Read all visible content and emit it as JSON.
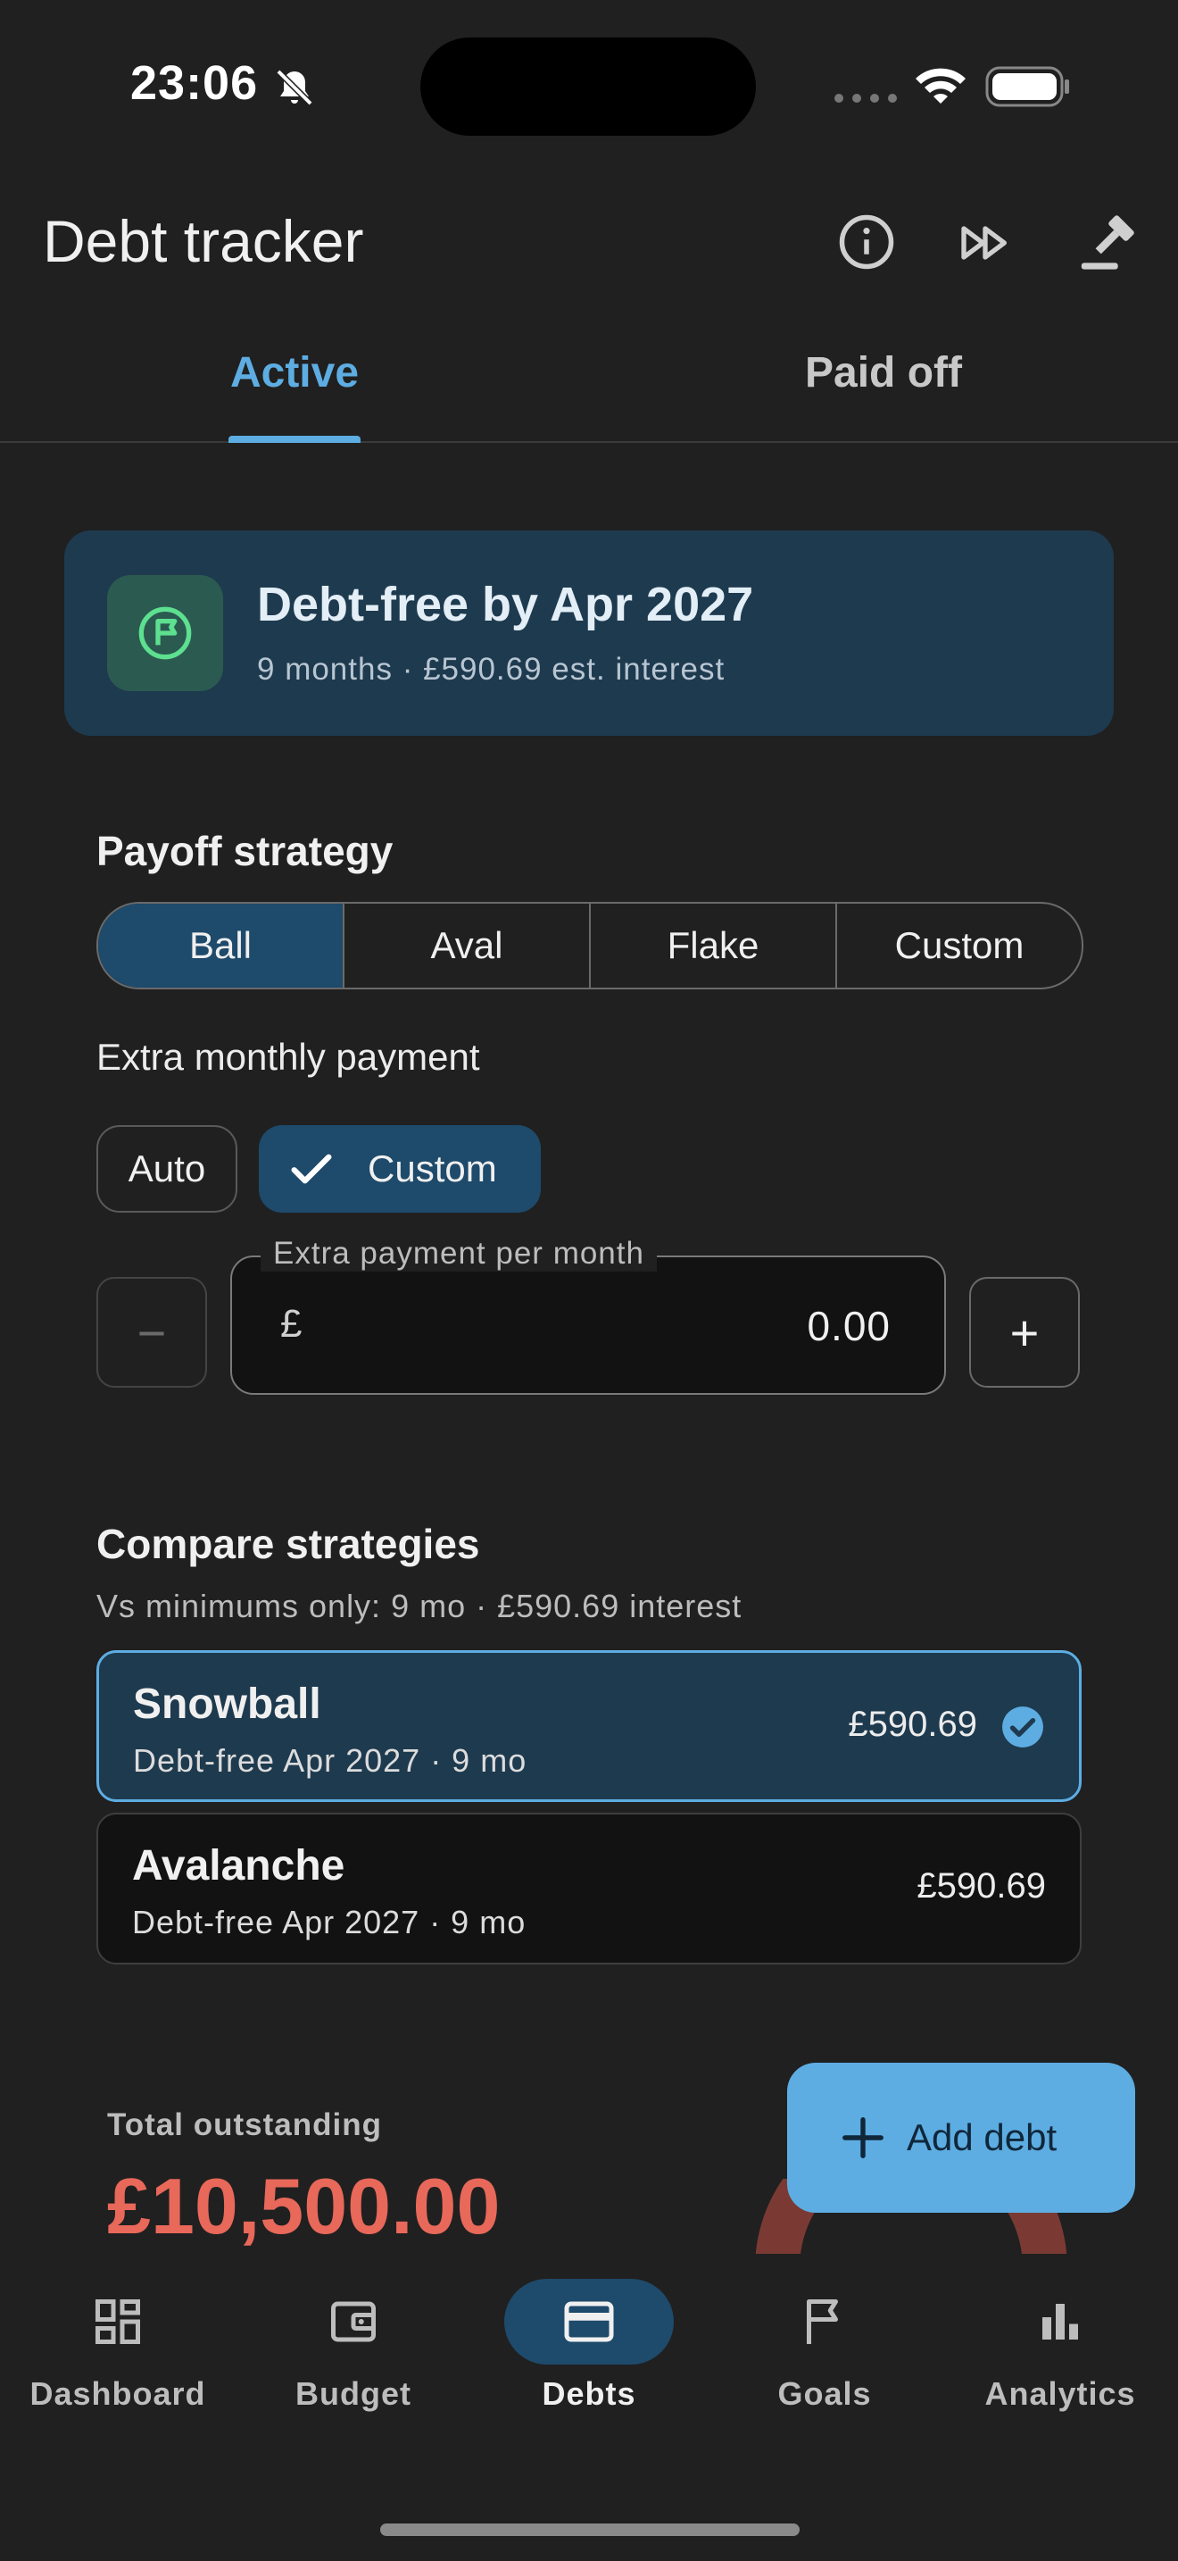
{
  "status_bar": {
    "time": "23:06"
  },
  "app_bar": {
    "title": "Debt tracker",
    "icons": [
      "info-icon",
      "fast-forward-icon",
      "gavel-icon"
    ]
  },
  "tabs": [
    {
      "label": "Active",
      "selected": true
    },
    {
      "label": "Paid off",
      "selected": false
    }
  ],
  "banner": {
    "title": "Debt-free by Apr 2027",
    "subtitle": "9 months · £590.69 est. interest",
    "icon": "flag-icon"
  },
  "payoff": {
    "title": "Payoff strategy",
    "options": [
      "Ball",
      "Aval",
      "Flake",
      "Custom"
    ],
    "selected": "Ball"
  },
  "extra": {
    "title": "Extra monthly payment",
    "chips": [
      "Auto",
      "Custom"
    ],
    "selected_chip": "Custom",
    "field_label": "Extra payment per month",
    "currency": "£",
    "value": "0.00",
    "minus": "−",
    "plus": "+"
  },
  "compare": {
    "title": "Compare strategies",
    "subtitle": "Vs minimums only: 9 mo · £590.69 interest",
    "cards": [
      {
        "title": "Snowball",
        "subtitle": "Debt-free Apr 2027 · 9 mo",
        "amount": "£590.69",
        "selected": true
      },
      {
        "title": "Avalanche",
        "subtitle": "Debt-free Apr 2027 · 9 mo",
        "amount": "£590.69",
        "selected": false
      }
    ]
  },
  "total": {
    "label": "Total outstanding",
    "amount": "£10,500.00"
  },
  "fab": {
    "label": "Add debt"
  },
  "nav": [
    {
      "label": "Dashboard",
      "icon": "dashboard-icon",
      "selected": false
    },
    {
      "label": "Budget",
      "icon": "wallet-icon",
      "selected": false
    },
    {
      "label": "Debts",
      "icon": "credit-card-icon",
      "selected": true
    },
    {
      "label": "Goals",
      "icon": "flag-outline-icon",
      "selected": false
    },
    {
      "label": "Analytics",
      "icon": "bar-chart-icon",
      "selected": false
    }
  ],
  "colors": {
    "accent": "#5DADE2",
    "selected_bg": "#1E4A6B",
    "negative": "#E8685A",
    "background": "#202020"
  }
}
